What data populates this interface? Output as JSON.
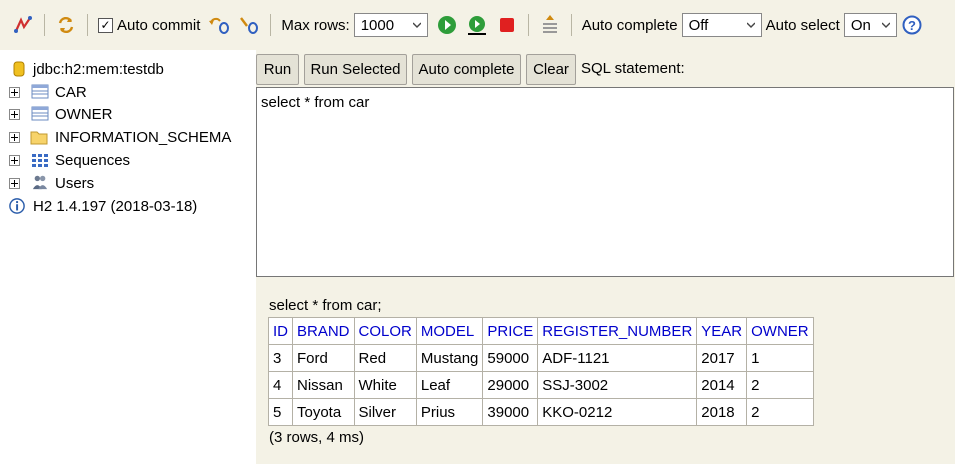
{
  "toolbar": {
    "auto_commit_label": "Auto commit",
    "auto_commit_checked": true,
    "max_rows_label": "Max rows:",
    "max_rows_value": "1000",
    "auto_complete_label": "Auto complete",
    "auto_complete_value": "Off",
    "auto_select_label": "Auto select",
    "auto_select_value": "On",
    "icons": [
      "disconnect-icon",
      "refresh-icon",
      "rollback-icon",
      "commit-icon",
      "run-icon",
      "run-selected-icon",
      "stop-icon",
      "history-icon",
      "help-icon"
    ]
  },
  "tree": {
    "connection": "jdbc:h2:mem:testdb",
    "items": [
      {
        "label": "CAR",
        "icon": "table-icon"
      },
      {
        "label": "OWNER",
        "icon": "table-icon"
      },
      {
        "label": "INFORMATION_SCHEMA",
        "icon": "folder-icon"
      },
      {
        "label": "Sequences",
        "icon": "sequences-icon"
      },
      {
        "label": "Users",
        "icon": "users-icon"
      }
    ],
    "version": "H2 1.4.197 (2018-03-18)"
  },
  "buttons": {
    "run": "Run",
    "run_selected": "Run Selected",
    "auto_complete": "Auto complete",
    "clear": "Clear"
  },
  "sql_caption": "SQL statement:",
  "editor_text": "select * from car",
  "result": {
    "query": "select * from car;",
    "columns": [
      "ID",
      "BRAND",
      "COLOR",
      "MODEL",
      "PRICE",
      "REGISTER_NUMBER",
      "YEAR",
      "OWNER"
    ],
    "rows": [
      [
        "3",
        "Ford",
        "Red",
        "Mustang",
        "59000",
        "ADF-1121",
        "2017",
        "1"
      ],
      [
        "4",
        "Nissan",
        "White",
        "Leaf",
        "29000",
        "SSJ-3002",
        "2014",
        "2"
      ],
      [
        "5",
        "Toyota",
        "Silver",
        "Prius",
        "39000",
        "KKO-0212",
        "2018",
        "2"
      ]
    ],
    "footer": "(3 rows, 4 ms)"
  },
  "colors": {
    "panel_bg": "#f4f2e6",
    "header_text": "#0000cc",
    "run_green": "#2e9d3a",
    "stop_red": "#e02020"
  }
}
